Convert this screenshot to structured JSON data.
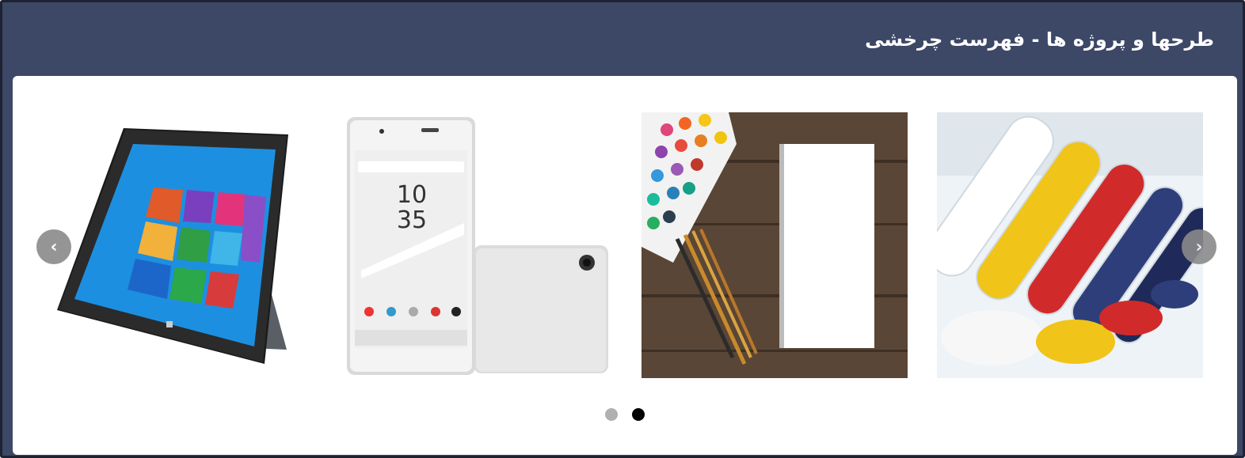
{
  "header": {
    "title": "طرحها و پروژه ها - فهرست چرخشی"
  },
  "carousel": {
    "prev_icon": "‹",
    "next_icon": "›",
    "slides": [
      {
        "name": "tablet-image",
        "icon": "tablet"
      },
      {
        "name": "smartphone-image",
        "icon": "phone"
      },
      {
        "name": "paint-notebook-image",
        "icon": "palette"
      },
      {
        "name": "plastic-granules-image",
        "icon": "granules"
      }
    ],
    "phone_clock": {
      "hour": "10",
      "minute": "35"
    },
    "pagination": {
      "count": 2,
      "active_index": 1
    }
  },
  "colors": {
    "header_bg": "#3d4766",
    "panel_bg": "#ffffff",
    "dot_active": "#000000",
    "dot_inactive": "#b0b0b0"
  }
}
